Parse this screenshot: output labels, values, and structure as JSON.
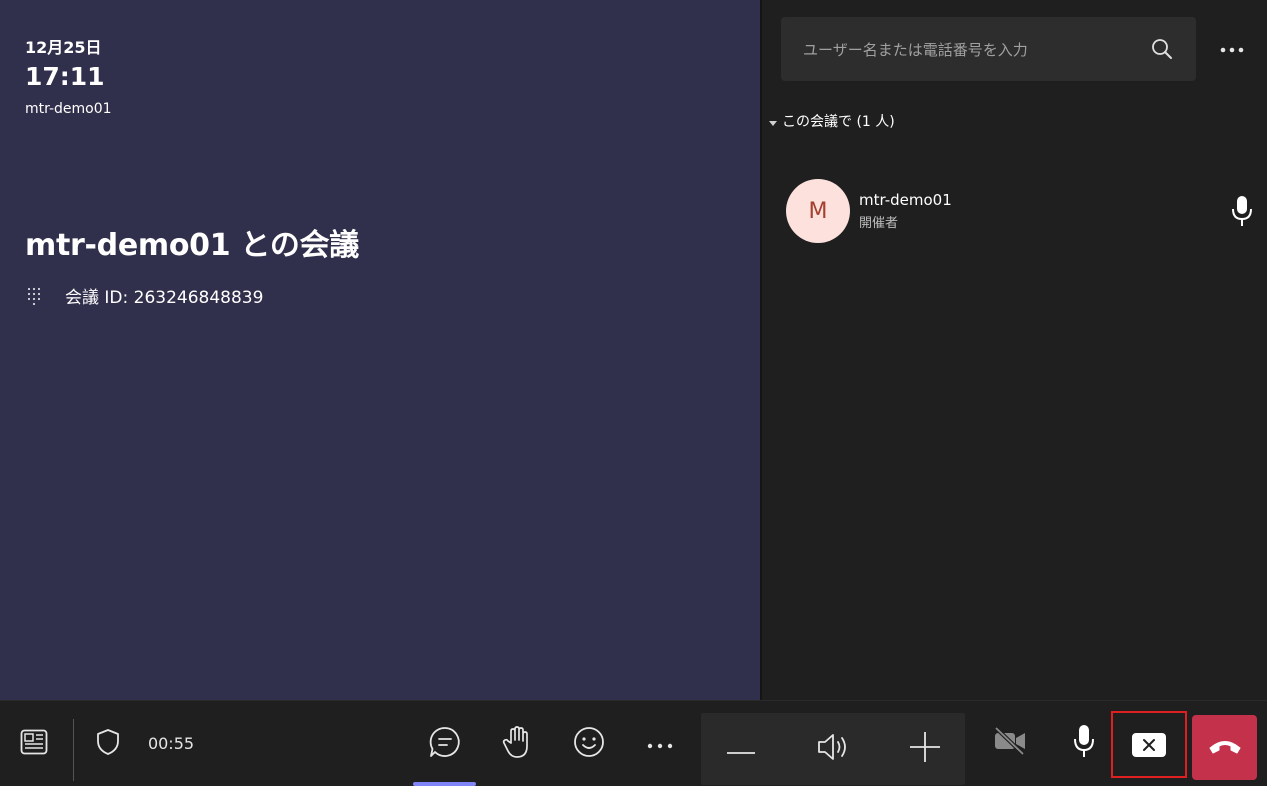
{
  "meeting": {
    "date": "12月25日",
    "time": "17:11",
    "room_name": "mtr-demo01",
    "title": "mtr-demo01 との会議",
    "meeting_id": "会議 ID: 263246848839"
  },
  "participants_panel": {
    "search_placeholder": "ユーザー名または電話番号を入力",
    "section_header": "この会議で (1 人)",
    "participants": [
      {
        "initial": "M",
        "name": "mtr-demo01",
        "role": "開催者"
      }
    ]
  },
  "toolbar": {
    "timer": "00:55",
    "icons": {
      "layout": "layout-icon",
      "shield": "shield-icon",
      "chat": "chat-icon",
      "raise_hand": "raise-hand-icon",
      "reactions": "emoji-icon",
      "more": "more-icon",
      "volume_down": "minus-icon",
      "speaker": "speaker-icon",
      "volume_up": "plus-icon",
      "camera_off": "camera-off-icon",
      "mic": "mic-icon",
      "close": "close-icon",
      "hangup": "hangup-icon"
    }
  },
  "colors": {
    "meeting_panel_bg": "#30304c",
    "side_panel_bg": "#1f1f1f",
    "avatar_bg": "#fde1dd",
    "avatar_text": "#a3402f",
    "hangup_red": "#c4314b",
    "highlight_border": "#e02020",
    "chat_active_underline": "#7f85f5"
  }
}
